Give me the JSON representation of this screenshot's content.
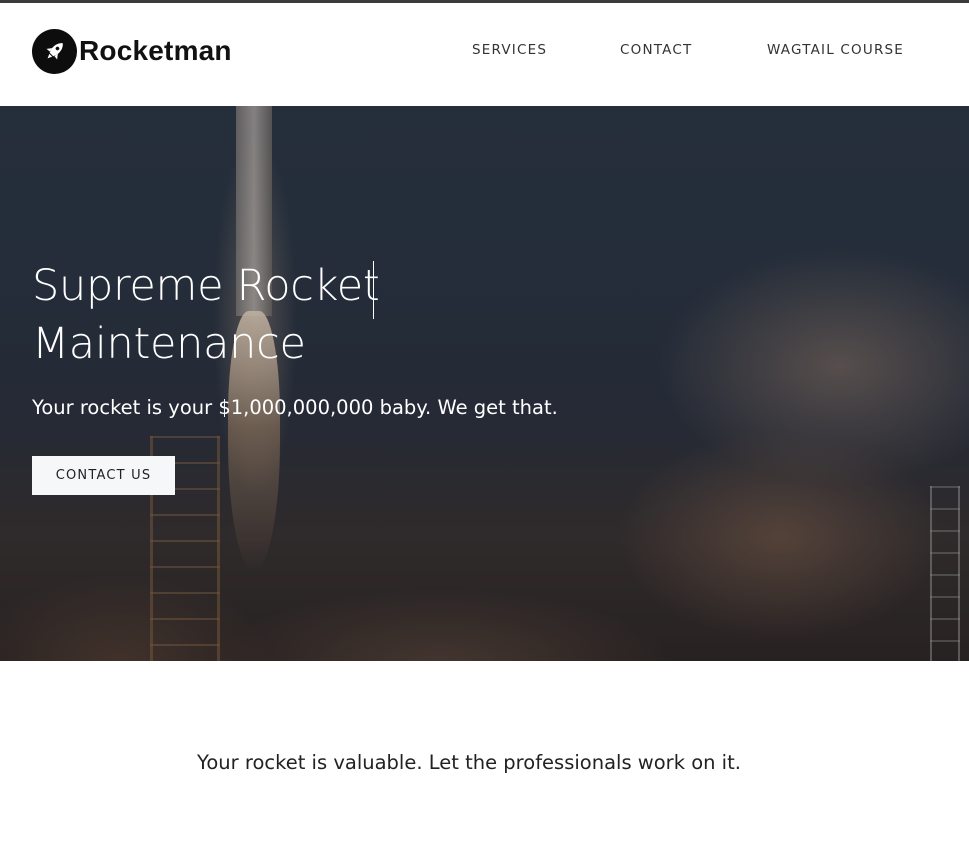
{
  "brand": {
    "name": "Rocketman",
    "logo_icon": "rocket-icon"
  },
  "nav": {
    "items": [
      {
        "label": "SERVICES"
      },
      {
        "label": "CONTACT"
      },
      {
        "label": "WAGTAIL COURSE"
      }
    ]
  },
  "hero": {
    "title": "Supreme Rocket Maintenance",
    "subtitle": "Your rocket is your $1,000,000,000 baby. We get that.",
    "button_label": "CONTACT US",
    "background_image": "rocket-launch-photo"
  },
  "intro": {
    "tagline": "Your rocket is valuable. Let the professionals work on it."
  },
  "colors": {
    "nav_text": "#333333",
    "button_bg": "#f6f7f9",
    "logo_badge": "#0d0d0d"
  }
}
